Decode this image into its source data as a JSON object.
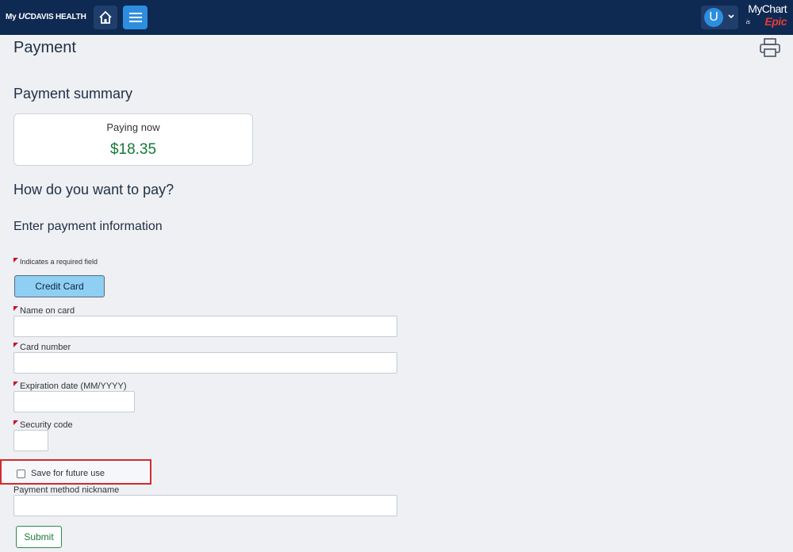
{
  "header": {
    "logo_prefix": "My",
    "logo_uc": "UC",
    "logo_rest": "DAVIS HEALTH",
    "home_icon": "home-icon",
    "menu_icon": "hamburger-menu-icon",
    "user_initial": "U",
    "mychart_text": "MyChart",
    "mychart_is": "is",
    "mychart_epic": "Epic"
  },
  "page": {
    "title": "Payment",
    "print_icon": "printer-icon"
  },
  "summary": {
    "heading": "Payment summary",
    "label": "Paying now",
    "amount": "$18.35"
  },
  "pay": {
    "heading": "How do you want to pay?",
    "subheading": "Enter payment information",
    "required_note": "Indicates a required field",
    "method_button": "Credit Card"
  },
  "form": {
    "name_label": "Name on card",
    "card_label": "Card number",
    "exp_label": "Expiration date (MM/YYYY)",
    "cvv_label": "Security code",
    "save_label": "Save for future use",
    "nickname_label": "Payment method nickname",
    "submit_label": "Submit"
  },
  "colors": {
    "header_bg": "#0e2a52",
    "accent_blue": "#2d8ee0",
    "amount_green": "#137a38",
    "required_red": "#c8102e",
    "highlight_red": "#d22b2b"
  }
}
